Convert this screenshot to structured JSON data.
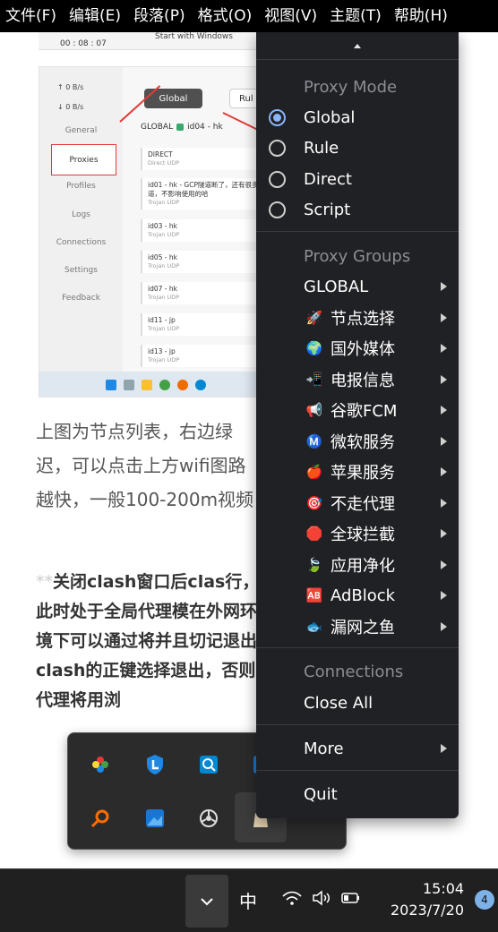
{
  "menubar": {
    "items": [
      "文件(F)",
      "编辑(E)",
      "段落(P)",
      "格式(O)",
      "视图(V)",
      "主题(T)",
      "帮助(H)"
    ]
  },
  "document": {
    "top_strip": {
      "time": "00 : 08 : 07",
      "startup_text": "Start with Windows"
    },
    "embedded": {
      "speed_up": "↑   0    B/s",
      "speed_down": "↓   0    B/s",
      "nav": [
        "General",
        "Proxies",
        "Profiles",
        "Logs",
        "Connections",
        "Settings",
        "Feedback"
      ],
      "mode_buttons": {
        "global": "Global",
        "rule": "Rul"
      },
      "group_label": "GLOBAL",
      "group_selected": "id04 - hk",
      "proxies": [
        {
          "name": "DIRECT",
          "tag": "Direct  UDP"
        },
        {
          "name": "id01 - hk - GCP隧道断了，还有很多隧道，不影响使用的哈",
          "tag": "Trojan  UDP"
        },
        {
          "name": "id03 - hk",
          "tag": "Trojan  UDP"
        },
        {
          "name": "id05 - hk",
          "tag": "Trojan  UDP"
        },
        {
          "name": "id07 - hk",
          "tag": "Trojan  UDP"
        },
        {
          "name": "id11 - jp",
          "tag": "Trojan  UDP"
        },
        {
          "name": "id13 - jp",
          "tag": "Trojan  UDP"
        }
      ]
    },
    "paragraph1": "上图为节点列表，右边绿迟，可以点击上方wifi图路越快，一般100-200m视频",
    "paragraph2_stars": "**",
    "paragraph2": "关闭clash窗口后clas行，此时处于全局代理模在外网环境下可以通过将并且切记退出clash的正键选择退出，否则代理将用浏"
  },
  "menu": {
    "proxy_mode_header": "Proxy Mode",
    "modes": [
      {
        "label": "Global",
        "selected": true
      },
      {
        "label": "Rule",
        "selected": false
      },
      {
        "label": "Direct",
        "selected": false
      },
      {
        "label": "Script",
        "selected": false
      }
    ],
    "proxy_groups_header": "Proxy Groups",
    "global_label": "GLOBAL",
    "groups": [
      {
        "icon": "🚀",
        "icon_name": "rocket-icon",
        "label": "节点选择"
      },
      {
        "icon": "🌍",
        "icon_name": "globe-icon",
        "label": "国外媒体"
      },
      {
        "icon": "📲",
        "icon_name": "telegram-icon",
        "label": "电报信息"
      },
      {
        "icon": "📢",
        "icon_name": "megaphone-icon",
        "label": "谷歌FCM"
      },
      {
        "icon": "Ⓜ️",
        "icon_name": "m-circle-icon",
        "label": "微软服务"
      },
      {
        "icon": "🍎",
        "icon_name": "apple-icon",
        "label": "苹果服务"
      },
      {
        "icon": "🎯",
        "icon_name": "target-icon",
        "label": "不走代理"
      },
      {
        "icon": "🛑",
        "icon_name": "stop-icon",
        "label": "全球拦截"
      },
      {
        "icon": "🍃",
        "icon_name": "leaf-icon",
        "label": "应用净化"
      },
      {
        "icon": "🆎",
        "icon_name": "ab-icon",
        "label": "AdBlock"
      },
      {
        "icon": "🐟",
        "icon_name": "fish-icon",
        "label": "漏网之鱼"
      }
    ],
    "connections_header": "Connections",
    "close_all": "Close All",
    "more": "More",
    "quit": "Quit"
  },
  "taskbar": {
    "ime": "中",
    "time": "15:04",
    "date": "2023/7/20",
    "notifications": "4"
  },
  "colors": {
    "accent": "#8ab4f8",
    "menu_bg": "#202124",
    "header": "#8a8d93"
  }
}
